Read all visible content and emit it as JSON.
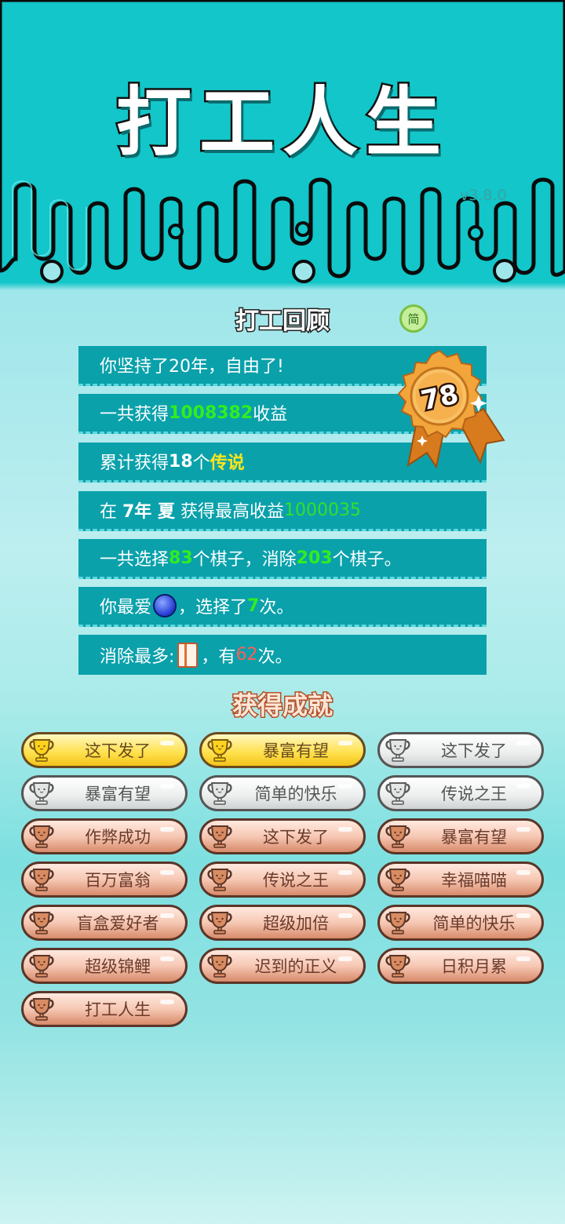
{
  "app": {
    "title": "打工人生",
    "version": "v3.8.0"
  },
  "review": {
    "title": "打工回顾",
    "simp_label": "简",
    "score": "78",
    "rows": [
      {
        "parts": [
          "你坚持了20年，自由了!"
        ]
      },
      {
        "parts": [
          "一共获得",
          "1008382",
          "收益"
        ]
      },
      {
        "parts": [
          "累计获得",
          "18",
          "个",
          "传说"
        ]
      },
      {
        "parts": [
          "在 ",
          "7年 夏",
          " 获得最高收益",
          "1000035"
        ]
      },
      {
        "parts": [
          "一共选择",
          "83",
          "个棋子，消除",
          "203",
          "个棋子。"
        ]
      },
      {
        "parts": [
          "你最爱",
          "，选择了",
          "7",
          "次。"
        ]
      },
      {
        "parts": [
          "消除最多:",
          "，有",
          "62",
          "次。"
        ]
      }
    ]
  },
  "achievements": {
    "title": "获得成就",
    "items": [
      {
        "label": "这下发了",
        "tier": "gold"
      },
      {
        "label": "暴富有望",
        "tier": "gold"
      },
      {
        "label": "这下发了",
        "tier": "silver"
      },
      {
        "label": "暴富有望",
        "tier": "silver"
      },
      {
        "label": "简单的快乐",
        "tier": "silver"
      },
      {
        "label": "传说之王",
        "tier": "silver"
      },
      {
        "label": "作弊成功",
        "tier": "bronze"
      },
      {
        "label": "这下发了",
        "tier": "bronze"
      },
      {
        "label": "暴富有望",
        "tier": "bronze"
      },
      {
        "label": "百万富翁",
        "tier": "bronze"
      },
      {
        "label": "传说之王",
        "tier": "bronze"
      },
      {
        "label": "幸福喵喵",
        "tier": "bronze"
      },
      {
        "label": "盲盒爱好者",
        "tier": "bronze"
      },
      {
        "label": "超级加倍",
        "tier": "bronze"
      },
      {
        "label": "简单的快乐",
        "tier": "bronze"
      },
      {
        "label": "超级锦鲤",
        "tier": "bronze"
      },
      {
        "label": "迟到的正义",
        "tier": "bronze"
      },
      {
        "label": "日积月累",
        "tier": "bronze"
      },
      {
        "label": "打工人生",
        "tier": "bronze"
      }
    ]
  },
  "colors": {
    "teal": "#12c6c9",
    "row_bg": "#0aa1ab",
    "highlight_green": "#30ee1f",
    "highlight_yellow": "#ffe61a",
    "highlight_red": "#ff5d55"
  }
}
